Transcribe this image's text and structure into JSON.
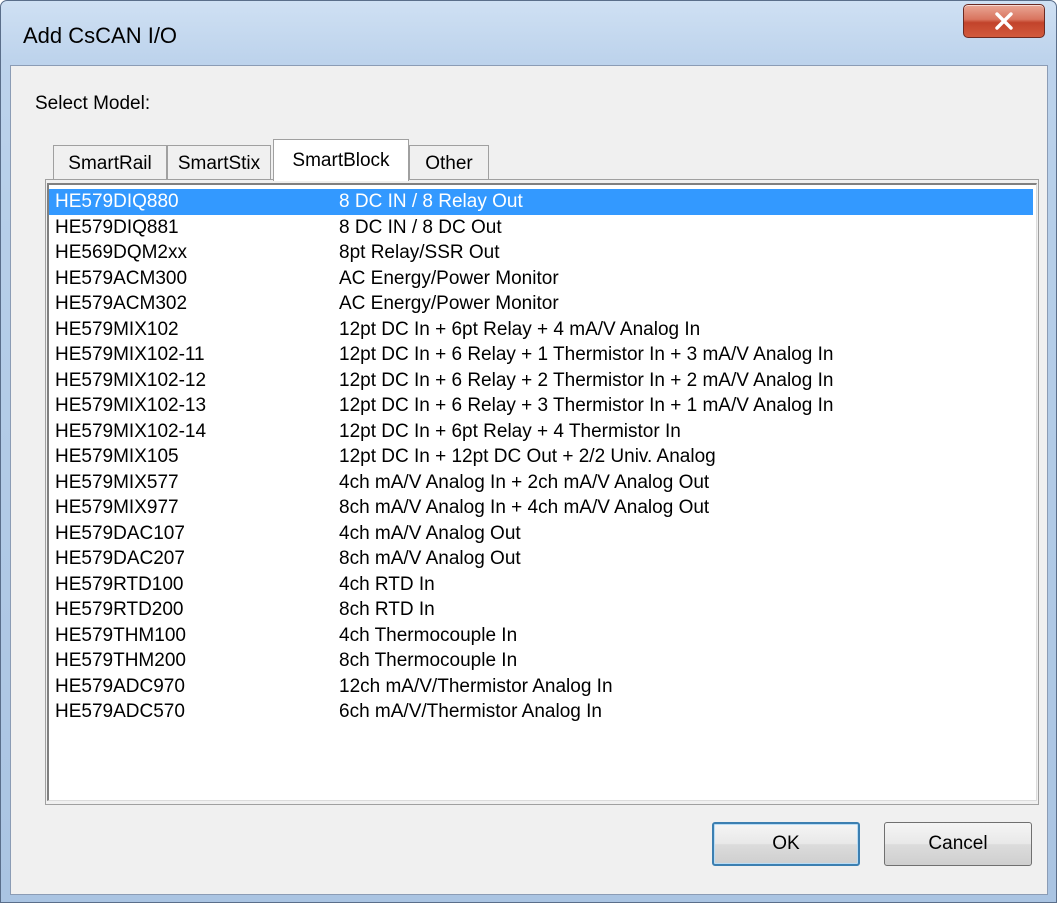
{
  "window": {
    "title": "Add CsCAN I/O",
    "close_icon": "close-icon"
  },
  "select_model_label": "Select Model:",
  "tabs": [
    {
      "label": "SmartRail",
      "active": false
    },
    {
      "label": "SmartStix",
      "active": false
    },
    {
      "label": "SmartBlock",
      "active": true
    },
    {
      "label": "Other",
      "active": false
    }
  ],
  "models": [
    {
      "model": "HE579DIQ880",
      "description": "8 DC IN / 8 Relay Out",
      "selected": true
    },
    {
      "model": "HE579DIQ881",
      "description": "8 DC IN / 8 DC Out",
      "selected": false
    },
    {
      "model": "HE569DQM2xx",
      "description": "8pt Relay/SSR Out",
      "selected": false
    },
    {
      "model": "HE579ACM300",
      "description": "AC Energy/Power Monitor",
      "selected": false
    },
    {
      "model": "HE579ACM302",
      "description": "AC Energy/Power Monitor",
      "selected": false
    },
    {
      "model": "HE579MIX102",
      "description": "12pt DC In + 6pt Relay + 4 mA/V Analog In",
      "selected": false
    },
    {
      "model": "HE579MIX102-11",
      "description": "12pt DC In + 6 Relay + 1 Thermistor In + 3 mA/V Analog In",
      "selected": false
    },
    {
      "model": "HE579MIX102-12",
      "description": "12pt DC In + 6 Relay + 2 Thermistor In + 2 mA/V Analog In",
      "selected": false
    },
    {
      "model": "HE579MIX102-13",
      "description": "12pt DC In + 6 Relay + 3 Thermistor In + 1 mA/V Analog In",
      "selected": false
    },
    {
      "model": "HE579MIX102-14",
      "description": "12pt DC In + 6pt Relay + 4 Thermistor In",
      "selected": false
    },
    {
      "model": "HE579MIX105",
      "description": "12pt DC In + 12pt DC Out + 2/2 Univ. Analog",
      "selected": false
    },
    {
      "model": "HE579MIX577",
      "description": "4ch mA/V Analog In + 2ch mA/V Analog Out",
      "selected": false
    },
    {
      "model": "HE579MIX977",
      "description": "8ch mA/V Analog In + 4ch mA/V Analog Out",
      "selected": false
    },
    {
      "model": "HE579DAC107",
      "description": "4ch mA/V Analog Out",
      "selected": false
    },
    {
      "model": "HE579DAC207",
      "description": "8ch mA/V Analog Out",
      "selected": false
    },
    {
      "model": "HE579RTD100",
      "description": "4ch RTD In",
      "selected": false
    },
    {
      "model": "HE579RTD200",
      "description": "8ch RTD In",
      "selected": false
    },
    {
      "model": "HE579THM100",
      "description": "4ch Thermocouple In",
      "selected": false
    },
    {
      "model": "HE579THM200",
      "description": "8ch Thermocouple In",
      "selected": false
    },
    {
      "model": "HE579ADC970",
      "description": "12ch mA/V/Thermistor Analog In",
      "selected": false
    },
    {
      "model": "HE579ADC570",
      "description": "6ch mA/V/Thermistor Analog In",
      "selected": false
    }
  ],
  "buttons": {
    "ok_label": "OK",
    "cancel_label": "Cancel"
  },
  "colors": {
    "selection": "#3399ff",
    "selection_text": "#ffffff",
    "close_button": "#c2432b"
  }
}
